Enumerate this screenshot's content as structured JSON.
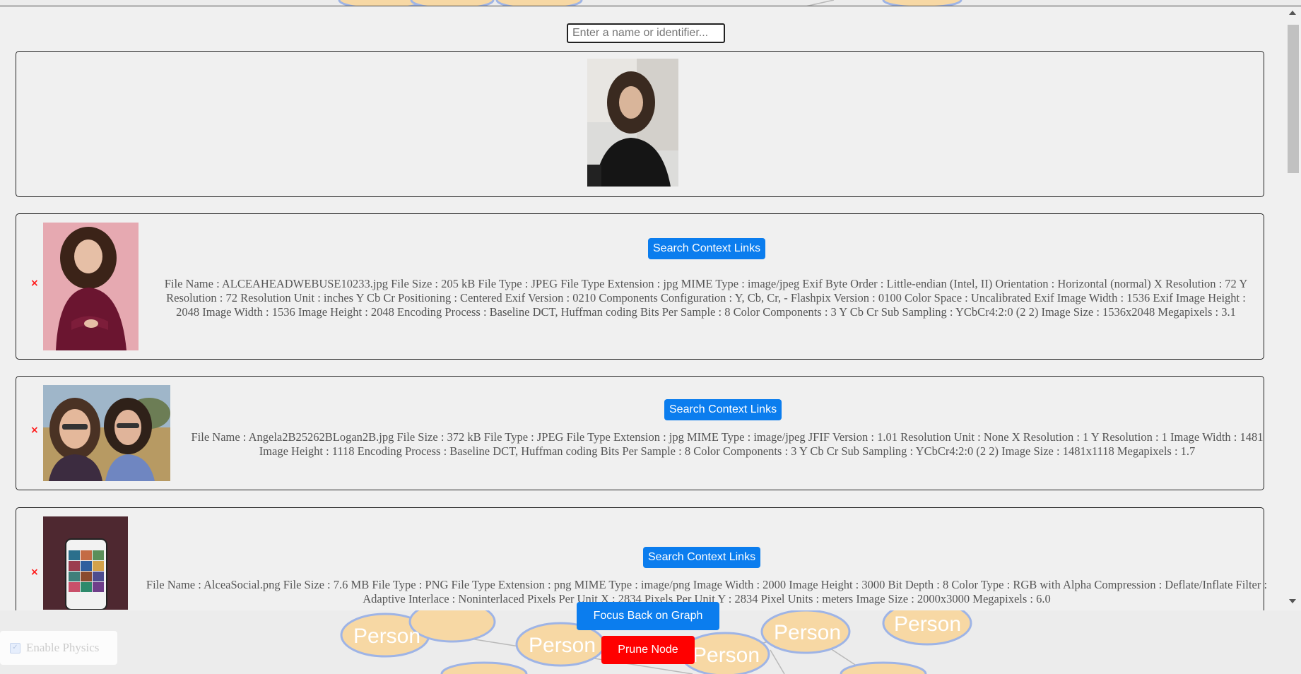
{
  "search": {
    "placeholder": "Enter a name or identifier..."
  },
  "graph": {
    "node_label": "Person",
    "bg_color": "#ececec",
    "node_fill": "#f7d8a4",
    "node_stroke": "#9eb4e6"
  },
  "cards": [
    {
      "thumb_icon": "portrait-photo",
      "meta": ""
    },
    {
      "thumb_icon": "portrait-photo-pink-background",
      "button_label": "Search Context Links",
      "meta": "File Name : ALCEAHEADWEBUSE10233.jpg File Size : 205 kB File Type : JPEG File Type Extension : jpg MIME Type : image/jpeg Exif Byte Order : Little-endian (Intel, II) Orientation : Horizontal (normal) X Resolution : 72 Y Resolution : 72 Resolution Unit : inches Y Cb Cr Positioning : Centered Exif Version : 0210 Components Configuration : Y, Cb, Cr, - Flashpix Version : 0100 Color Space : Uncalibrated Exif Image Width : 1536 Exif Image Height : 2048 Image Width : 1536 Image Height : 2048 Encoding Process : Baseline DCT, Huffman coding Bits Per Sample : 8 Color Components : 3 Y Cb Cr Sub Sampling : YCbCr4:2:0 (2 2) Image Size : 1536x2048 Megapixels : 3.1"
    },
    {
      "thumb_icon": "selfie-photo-two-people",
      "button_label": "Search Context Links",
      "meta": "File Name : Angela2B25262BLogan2B.jpg File Size : 372 kB File Type : JPEG File Type Extension : jpg MIME Type : image/jpeg JFIF Version : 1.01 Resolution Unit : None X Resolution : 1 Y Resolution : 1 Image Width : 1481 Image Height : 1118 Encoding Process : Baseline DCT, Huffman coding Bits Per Sample : 8 Color Components : 3 Y Cb Cr Sub Sampling : YCbCr4:2:0 (2 2) Image Size : 1481x1118 Megapixels : 1.7"
    },
    {
      "thumb_icon": "phone-screenshot-photo",
      "button_label": "Search Context Links",
      "meta": "File Name : AlceaSocial.png File Size : 7.6 MB File Type : PNG File Type Extension : png MIME Type : image/png Image Width : 2000 Image Height : 3000 Bit Depth : 8 Color Type : RGB with Alpha Compression : Deflate/Inflate Filter : Adaptive Interlace : Noninterlaced Pixels Per Unit X : 2834 Pixels Per Unit Y : 2834 Pixel Units : meters Image Size : 2000x3000 Megapixels : 6.0"
    }
  ],
  "remove_symbol": "×",
  "buttons": {
    "focus_label": "Focus Back on Graph",
    "prune_label": "Prune Node"
  },
  "physics": {
    "label": "Enable Physics",
    "checked": true
  },
  "colors": {
    "primary_button": "#0b7dee",
    "danger_button": "#ff0000",
    "remove_x": "#ff1a1a"
  }
}
